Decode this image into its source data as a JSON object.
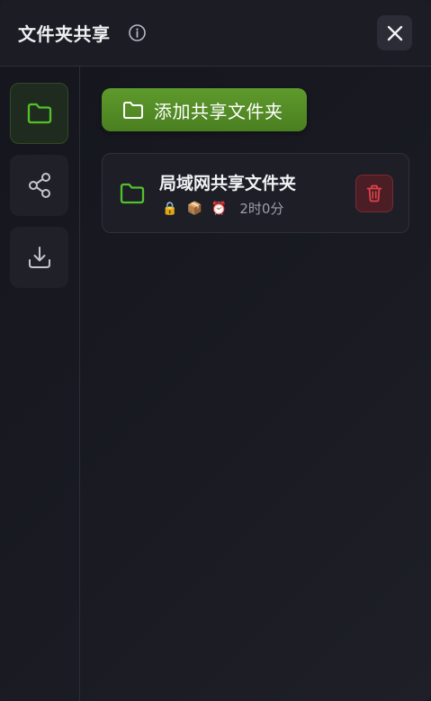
{
  "header": {
    "title": "文件夹共享",
    "info_icon": "info-circle-icon",
    "close_icon": "close-icon"
  },
  "sidebar": {
    "items": [
      {
        "icon": "folder-icon",
        "active": true
      },
      {
        "icon": "share-icon",
        "active": false
      },
      {
        "icon": "download-icon",
        "active": false
      }
    ]
  },
  "main": {
    "add_button_label": "添加共享文件夹",
    "shared_folders": [
      {
        "name": "局域网共享文件夹",
        "lock": "🔒",
        "package": "📦",
        "alarm": "⏰",
        "duration": "2时0分"
      }
    ]
  },
  "colors": {
    "accent_green": "#5e9a2c",
    "folder_green": "#52c22b",
    "delete_red": "#e0414c"
  }
}
